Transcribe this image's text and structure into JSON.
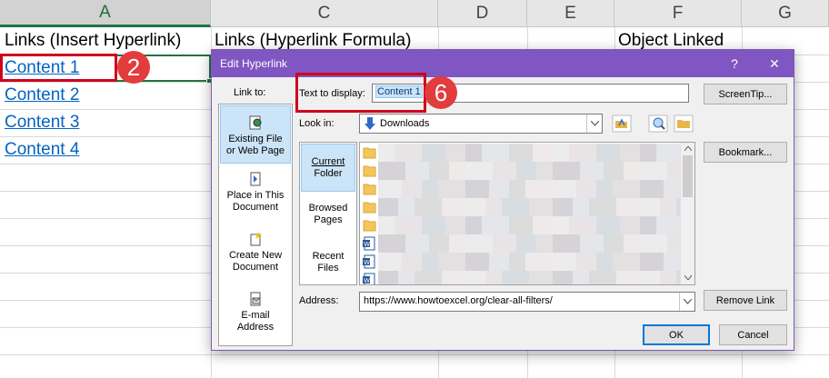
{
  "sheet": {
    "columns": [
      "A",
      "C",
      "D",
      "E",
      "F",
      "G"
    ],
    "header_a1": "Links (Insert Hyperlink)",
    "header_c1": "Links (Hyperlink Formula)",
    "header_f1": "Object Linked",
    "links": [
      "Content 1",
      "Content 2",
      "Content 3",
      "Content 4"
    ]
  },
  "badges": {
    "cell_step": "2",
    "text_step": "6"
  },
  "dialog": {
    "title": "Edit Hyperlink",
    "help": "?",
    "close": "✕",
    "link_to_label": "Link to:",
    "link_to": [
      {
        "line1": "Existing File",
        "line2": "or Web Page"
      },
      {
        "line1": "Place in This",
        "line2": "Document"
      },
      {
        "line1": "Create New",
        "line2": "Document"
      },
      {
        "line1": "E-mail",
        "line2": "Address"
      }
    ],
    "text_to_display_label": "Text to display:",
    "text_to_display_value": "Content 1",
    "screentip_button": "ScreenTip...",
    "look_in_label": "Look in:",
    "look_in_value": "Downloads",
    "folder_tabs": [
      {
        "line1": "Current",
        "line2": "Folder"
      },
      {
        "line1": "Browsed",
        "line2": "Pages"
      },
      {
        "line1": "Recent",
        "line2": "Files"
      }
    ],
    "bookmark_button": "Bookmark...",
    "address_label": "Address:",
    "address_value": "https://www.howtoexcel.org/clear-all-filters/",
    "remove_link_button": "Remove Link",
    "ok_button": "OK",
    "cancel_button": "Cancel"
  },
  "colors": {
    "accent": "#7f56c2",
    "excel_green": "#217346",
    "link": "#0563c1",
    "highlight": "#d0021b"
  }
}
